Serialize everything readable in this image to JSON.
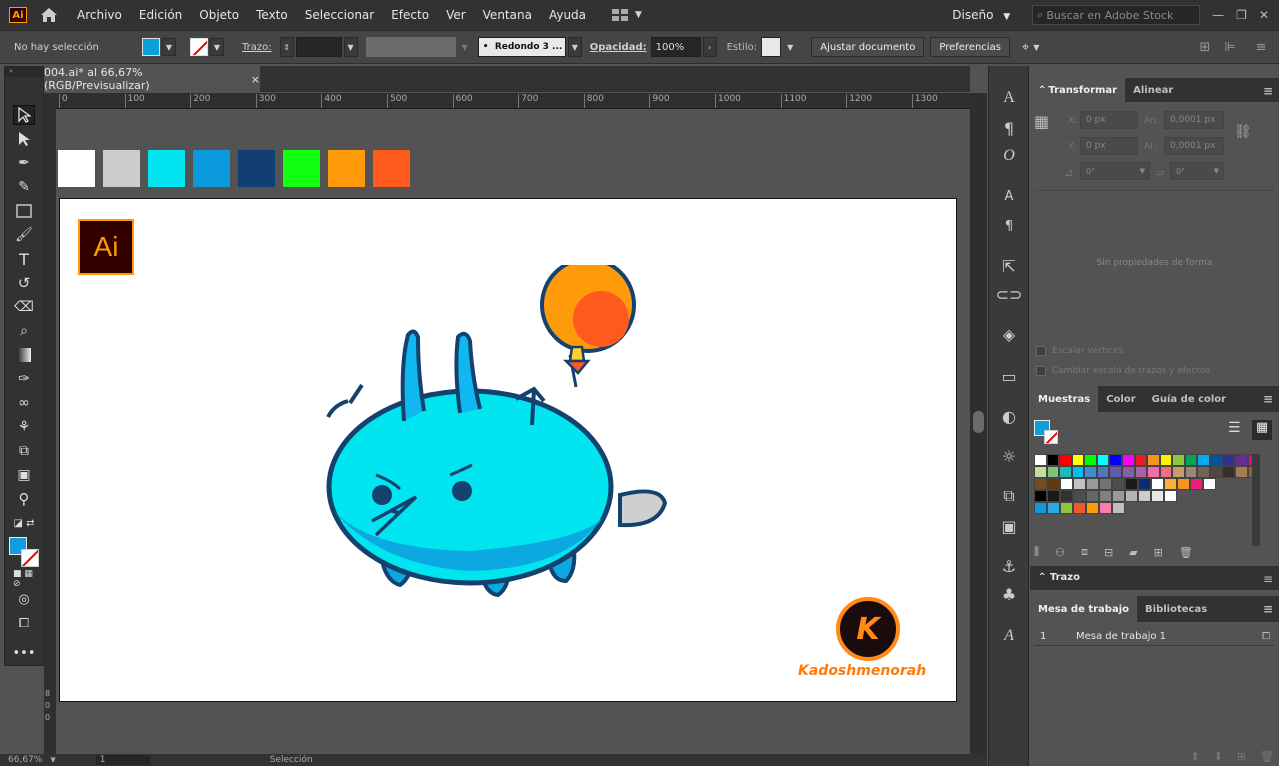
{
  "app": {
    "logo": "Ai"
  },
  "menu": [
    "Archivo",
    "Edición",
    "Objeto",
    "Texto",
    "Seleccionar",
    "Efecto",
    "Ver",
    "Ventana",
    "Ayuda"
  ],
  "topright": {
    "workspace": "Diseño",
    "search_placeholder": "Buscar en Adobe Stock"
  },
  "control": {
    "selection": "No hay selección",
    "stroke_label": "Trazo:",
    "brush": "Redondo 3 ...",
    "opacity_label": "Opacidad:",
    "opacity_value": "100%",
    "style_label": "Estilo:",
    "doc_setup": "Ajustar documento",
    "prefs": "Preferencias"
  },
  "doc_tab": {
    "title": "004.ai* al 66,67% (RGB/Previsualizar)",
    "close": "×"
  },
  "ruler_ticks": [
    "0",
    "100",
    "200",
    "300",
    "400",
    "500",
    "600",
    "700",
    "800",
    "900",
    "1000",
    "1100",
    "1200",
    "1300"
  ],
  "ruler_v": [
    "8",
    "0",
    "0"
  ],
  "canvas_swatches": [
    "#ffffff",
    "#cccccc",
    "#00e5ef",
    "#0b9bdc",
    "#123f73",
    "#12ff12",
    "#ff9a0a",
    "#ff5a1e"
  ],
  "artwork": {
    "ai_badge": "Ai",
    "brand_letter": "K",
    "brand_name": "Kadoshmenorah"
  },
  "status": {
    "zoom": "66,67%",
    "artboard_num": "1",
    "tool": "Selección"
  },
  "transform": {
    "tabs": [
      "Transformar",
      "Alinear"
    ],
    "x_label": "X:",
    "x_value": "0 px",
    "y_label": "Y:",
    "y_value": "0 px",
    "w_label": "An.:",
    "w_value": "0,0001 px",
    "h_label": "Al.:",
    "h_value": "0,0001 px",
    "angle": "0°",
    "shear": "0°",
    "empty": "Sin propiedades de forma",
    "scale_corners": "Escalar vértices",
    "scale_strokes": "Cambiar escala de trazos y efectos"
  },
  "swatches_panel": {
    "tabs": [
      "Muestras",
      "Color",
      "Guía de color"
    ],
    "colors": [
      [
        "#ffffff",
        "#000000",
        "#ff0000",
        "#ffff00",
        "#00ff00",
        "#00ffff",
        "#0000ff",
        "#ff00ff",
        "#ed1c24",
        "#f7941d",
        "#fff200",
        "#8dc63f",
        "#00a651",
        "#00aeef",
        "#0054a6",
        "#2e3192",
        "#662d91",
        "#ec008c"
      ],
      [
        "#c4df9b",
        "#7cc576",
        "#1cbbb4",
        "#00bff3",
        "#448ccb",
        "#5674b9",
        "#605ca8",
        "#855fa8",
        "#a864a8",
        "#f06eaa",
        "#f26d7d",
        "#c69c6d",
        "#998675",
        "#736357",
        "#534741",
        "#362f2d",
        "#a67c52",
        "#8c6239"
      ],
      [
        "#754c24",
        "#603913",
        "#ffffff",
        "#c2c2c2",
        "#999999",
        "#737373",
        "#4d4d4d",
        "#1a1a1a",
        "#0c2d6b",
        "#ffffff",
        "#fbb03b",
        "#f7941d",
        "#ed1e79",
        "#ffffff"
      ],
      [
        "#000000",
        "#1a1a1a",
        "#333333",
        "#4d4d4d",
        "#666666",
        "#808080",
        "#999999",
        "#b3b3b3",
        "#cccccc",
        "#e6e6e6",
        "#ffffff"
      ],
      [
        "#0b9bdc",
        "#29abe2",
        "#8cc63f",
        "#f15a24",
        "#ff9a0a",
        "#ff7bac",
        "#c0c0c0"
      ]
    ]
  },
  "stroke_panel": {
    "title": "Trazo"
  },
  "artboards_panel": {
    "tabs": [
      "Mesa de trabajo",
      "Bibliotecas"
    ],
    "rows": [
      {
        "num": "1",
        "name": "Mesa de trabajo 1"
      }
    ]
  }
}
